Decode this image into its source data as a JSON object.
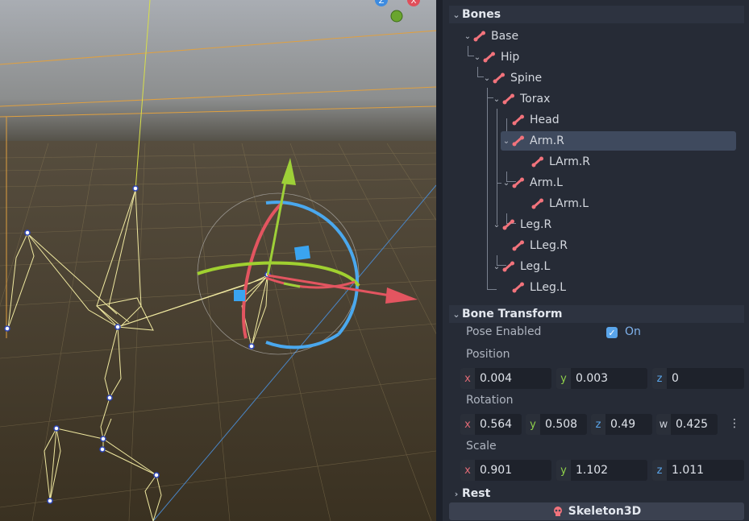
{
  "bones_section": {
    "title": "Bones"
  },
  "tree": [
    {
      "label": "Base",
      "expanded": true
    },
    {
      "label": "Hip",
      "expanded": true
    },
    {
      "label": "Spine",
      "expanded": true
    },
    {
      "label": "Torax",
      "expanded": true
    },
    {
      "label": "Head",
      "expanded": false
    },
    {
      "label": "Arm.R",
      "expanded": true,
      "selected": true
    },
    {
      "label": "LArm.R",
      "expanded": false
    },
    {
      "label": "Arm.L",
      "expanded": true
    },
    {
      "label": "LArm.L",
      "expanded": false
    },
    {
      "label": "Leg.R",
      "expanded": true
    },
    {
      "label": "LLeg.R",
      "expanded": false
    },
    {
      "label": "Leg.L",
      "expanded": true
    },
    {
      "label": "LLeg.L",
      "expanded": false
    }
  ],
  "bone_transform": {
    "title": "Bone Transform",
    "pose_enabled_label": "Pose Enabled",
    "pose_enabled_value": "On",
    "position": {
      "label": "Position",
      "x": "0.004",
      "y": "0.003",
      "z": "0"
    },
    "rotation": {
      "label": "Rotation",
      "x": "0.564",
      "y": "0.508",
      "z": "0.49",
      "w": "0.425"
    },
    "scale": {
      "label": "Scale",
      "x": "0.901",
      "y": "1.102",
      "z": "1.011"
    }
  },
  "axis_labels": {
    "x": "x",
    "y": "y",
    "z": "z",
    "w": "w"
  },
  "rest_section": {
    "title": "Rest"
  },
  "bottom_bar": {
    "label": "Skeleton3D",
    "icon": "skull-icon"
  },
  "gizmo_labels": {
    "z": "Z",
    "x": "X"
  },
  "colors": {
    "accent": "#5aa5ea",
    "bone_icon": "#f2737c",
    "x_axis": "#e06a75",
    "y_axis": "#8fd14a",
    "z_axis": "#5aa5ea"
  }
}
